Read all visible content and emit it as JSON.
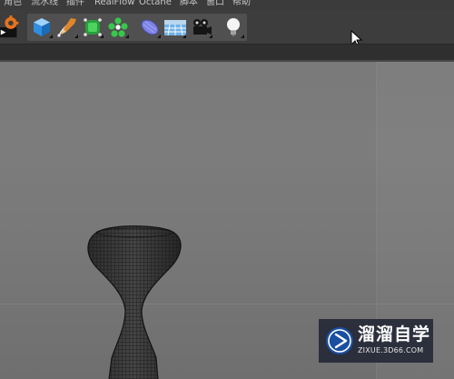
{
  "menubar": {
    "items": [
      {
        "label": "角色"
      },
      {
        "label": "流水线"
      },
      {
        "label": "插件"
      },
      {
        "label": "RealFlow"
      },
      {
        "label": "Octane"
      },
      {
        "label": "脚本"
      },
      {
        "label": "窗口"
      },
      {
        "label": "帮助"
      }
    ]
  },
  "toolbar": {
    "tools": [
      {
        "icon": "render-settings-icon"
      },
      {
        "icon": "cube-primitive-icon"
      },
      {
        "icon": "pen-spline-icon"
      },
      {
        "icon": "subdivision-cube-icon"
      },
      {
        "icon": "cloner-array-icon"
      },
      {
        "icon": "deformer-icon"
      },
      {
        "icon": "floor-plane-icon"
      },
      {
        "icon": "camera-icon"
      },
      {
        "icon": "light-bulb-icon"
      }
    ]
  },
  "watermark": {
    "title": "溜溜自学",
    "url": "ZIXUE.3D66.COM",
    "accent": "#1a4fa0"
  }
}
